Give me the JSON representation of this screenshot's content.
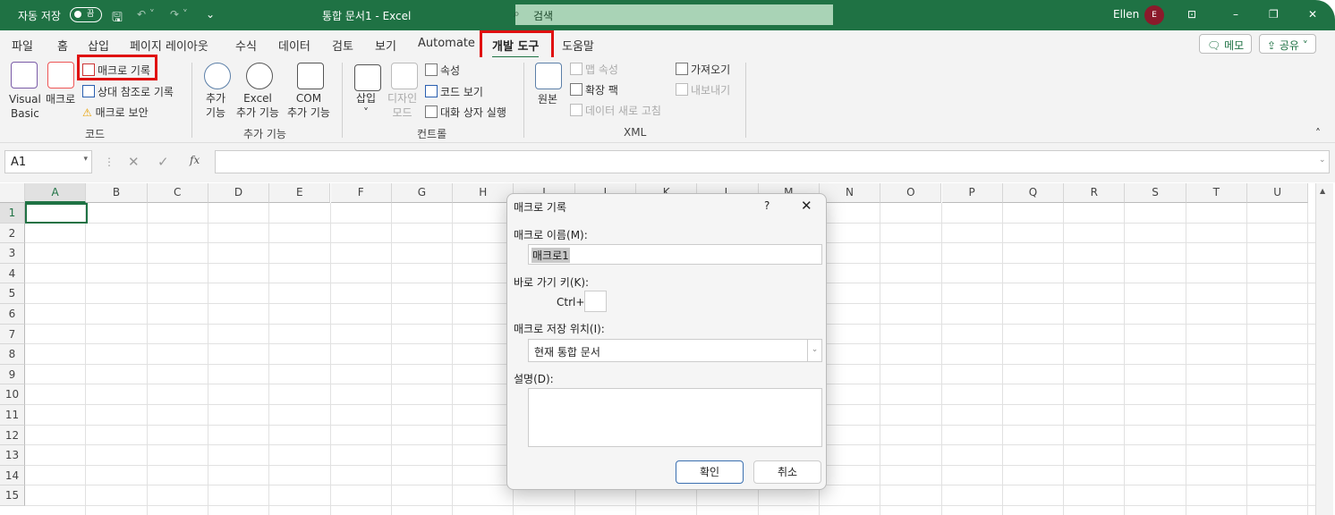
{
  "titlebar": {
    "autosave": "자동 저장",
    "autosave_state": "끔",
    "title": "통합 문서1  -  Excel",
    "search_placeholder": "검색",
    "user": "Ellen",
    "avatar_initial": "E"
  },
  "tabs": [
    "파일",
    "홈",
    "삽입",
    "페이지 레이아웃",
    "수식",
    "데이터",
    "검토",
    "보기",
    "Automate",
    "개발 도구",
    "도움말"
  ],
  "active_tab": "개발 도구",
  "header_buttons": {
    "memo": "메모",
    "share": "공유"
  },
  "ribbon": {
    "code": {
      "label": "코드",
      "visual_basic": [
        "Visual",
        "Basic"
      ],
      "macro": "매크로",
      "record_macro": "매크로 기록",
      "relative": "상대 참조로 기록",
      "security": "매크로 보안"
    },
    "addins": {
      "label": "추가 기능",
      "addin": [
        "추가",
        "기능"
      ],
      "excel_addin": [
        "Excel",
        "추가 기능"
      ],
      "com_addin": [
        "COM",
        "추가 기능"
      ]
    },
    "controls": {
      "label": "컨트롤",
      "insert": "삽입",
      "design_mode": [
        "디자인",
        "모드"
      ],
      "properties": "속성",
      "view_code": "코드 보기",
      "run_dialog": "대화 상자 실행"
    },
    "xml": {
      "label": "XML",
      "source": "원본",
      "map_props": "맵 속성",
      "expansion": "확장 팩",
      "refresh": "데이터 새로 고침",
      "import": "가져오기",
      "export": "내보내기"
    }
  },
  "formula": {
    "name_box": "A1",
    "fx": "fx",
    "value": ""
  },
  "sheet": {
    "columns": [
      "A",
      "B",
      "C",
      "D",
      "E",
      "F",
      "G",
      "H",
      "I",
      "J",
      "K",
      "L",
      "M",
      "N",
      "O",
      "P",
      "Q",
      "R",
      "S",
      "T",
      "U"
    ],
    "rows": [
      "1",
      "2",
      "3",
      "4",
      "5",
      "6",
      "7",
      "8",
      "9",
      "10",
      "11",
      "12",
      "13",
      "14",
      "15"
    ],
    "selected": "A1"
  },
  "dialog": {
    "title": "매크로 기록",
    "help": "?",
    "name_label": "매크로 이름(M):",
    "name_value": "매크로1",
    "shortcut_label": "바로 가기 키(K):",
    "ctrl": "Ctrl+",
    "shortcut_value": "",
    "store_label": "매크로 저장 위치(I):",
    "store_value": "현재 통합 문서",
    "desc_label": "설명(D):",
    "desc_value": "",
    "ok": "확인",
    "cancel": "취소"
  },
  "colors": {
    "accent": "#1f7244",
    "highlight": "#e01010"
  }
}
